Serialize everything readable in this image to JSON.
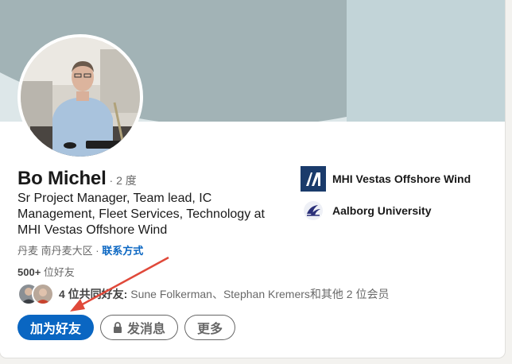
{
  "profile": {
    "name": "Bo Michel",
    "degree": "· 2 度",
    "headline": "Sr Project Manager, Team lead, IC Management, Fleet Services, Technology at MHI Vestas Offshore Wind",
    "location": "丹麦 南丹麦大区",
    "separator": " · ",
    "contact_info": "联系方式",
    "connections_count": "500+",
    "connections_label": " 位好友"
  },
  "mutual": {
    "count_text": "4 位共同好友:",
    "names_text": " Sune Folkerman、Stephan Kremers和其他 2 位会员"
  },
  "actions": {
    "connect_label": "加为好友",
    "message_label": "发消息",
    "more_label": "更多"
  },
  "organizations": [
    {
      "name": "MHI Vestas Offshore Wind",
      "logo": "mhi-vestas-logo"
    },
    {
      "name": "Aalborg University",
      "logo": "aalborg-university-logo"
    }
  ],
  "colors": {
    "primary": "#0a66c2",
    "annotation_arrow": "#e0493a",
    "cover_shape": "#a2b3b6",
    "cover_panel": "#c2d4d8"
  }
}
